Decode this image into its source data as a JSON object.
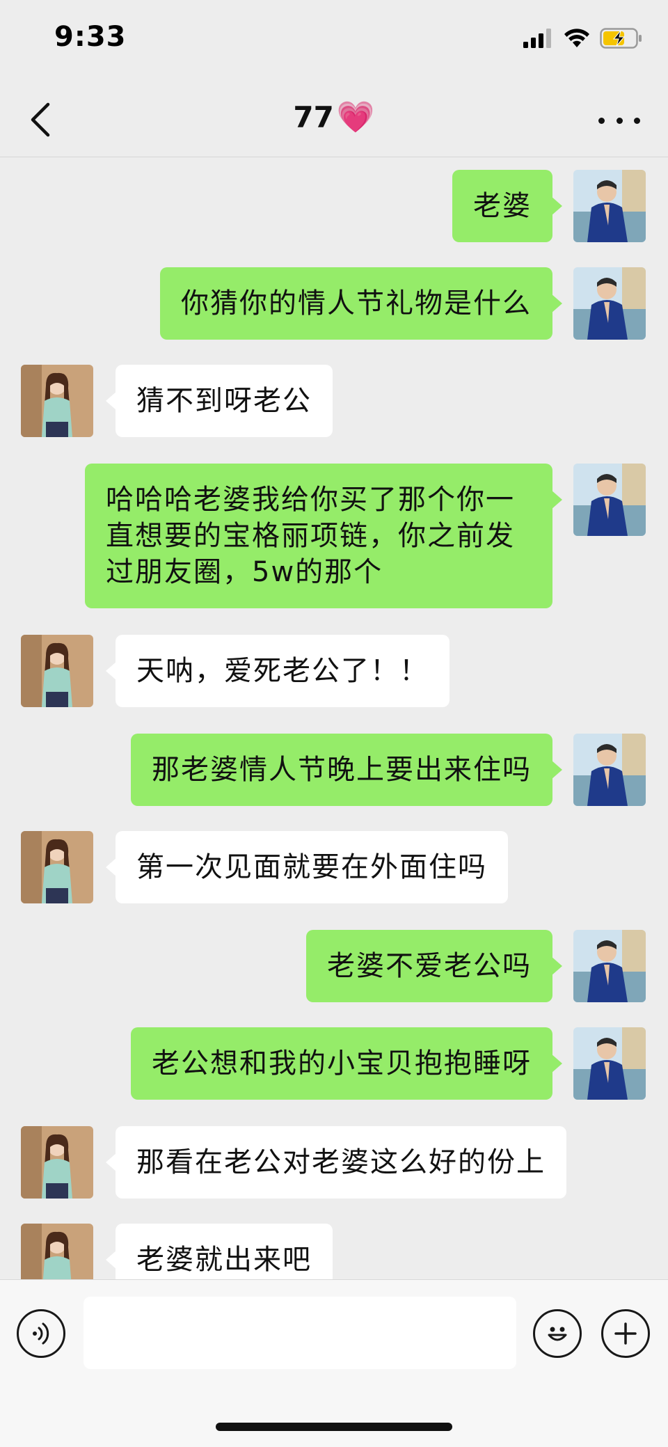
{
  "status_bar": {
    "time": "9:33"
  },
  "nav": {
    "title": "77",
    "title_emoji": "💗"
  },
  "colors": {
    "self_bubble": "#95ec69",
    "other_bubble": "#ffffff",
    "background": "#ededed"
  },
  "messages": [
    {
      "sender": "self",
      "text": "老婆"
    },
    {
      "sender": "self",
      "text": "你猜你的情人节礼物是什么"
    },
    {
      "sender": "other",
      "text": "猜不到呀老公"
    },
    {
      "sender": "self",
      "text": "哈哈哈老婆我给你买了那个你一\n直想要的宝格丽项链，你之前发\n过朋友圈，5w的那个"
    },
    {
      "sender": "other",
      "text": "天呐，爱死老公了！！"
    },
    {
      "sender": "self",
      "text": "那老婆情人节晚上要出来住吗"
    },
    {
      "sender": "other",
      "text": "第一次见面就要在外面住吗"
    },
    {
      "sender": "self",
      "text": "老婆不爱老公吗"
    },
    {
      "sender": "self",
      "text": "老公想和我的小宝贝抱抱睡呀"
    },
    {
      "sender": "other",
      "text": "那看在老公对老婆这么好的份上"
    },
    {
      "sender": "other",
      "text": "老婆就出来吧"
    }
  ],
  "input": {
    "value": ""
  },
  "icons": {
    "back": "chevron-left-icon",
    "more": "more-dots-icon",
    "voice": "voice-icon",
    "emoji": "emoji-icon",
    "plus": "plus-icon"
  }
}
